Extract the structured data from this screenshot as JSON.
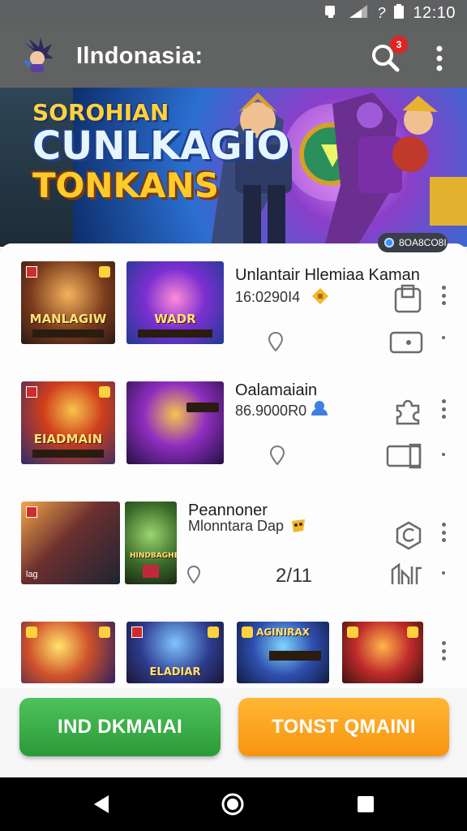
{
  "status_bar": {
    "time": "12:10"
  },
  "app_bar": {
    "title": "Ilndonasia:",
    "notification_count": "3"
  },
  "banner": {
    "line1": "SOROHIAN",
    "line2": "CUNLKAGIO",
    "line3": "TONKANS",
    "chip": "8OA8CO8I"
  },
  "rows": [
    {
      "title": "Unlantair Hlemiaa Kaman",
      "subtitle": "16:0290I4",
      "thumb1": {
        "label": "MANLAGIW"
      },
      "thumb2": {
        "label": "WADR"
      }
    },
    {
      "title": "Oalamaiain",
      "subtitle": "86.9000R0",
      "thumb1": {
        "label": "EIADMAIN"
      },
      "thumb2": {
        "label": ""
      }
    },
    {
      "title": "Peannoner",
      "subtitle": "Mlonntara Dap",
      "count": "2/11",
      "thumb1": {
        "label": ""
      },
      "thumb2": {
        "label": "HINDBAGHEES"
      },
      "tag": "lag"
    },
    {
      "thumb1": {
        "label": ""
      },
      "thumb2": {
        "label": "ELADIAR"
      },
      "thumb3": {
        "label": "AGINIRAX"
      },
      "thumb4": {
        "label": ""
      }
    }
  ],
  "actions": {
    "primary": "IND DKMAIAI",
    "secondary": "TONST QMAINI"
  },
  "colors": {
    "accent_green": "#2a9a38",
    "accent_orange": "#f79410",
    "badge_red": "#e02424",
    "appbar": "#616262"
  }
}
